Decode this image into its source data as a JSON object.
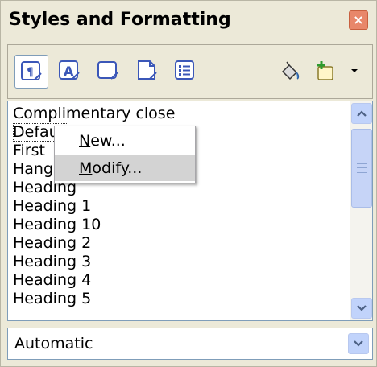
{
  "panel": {
    "title": "Styles and Formatting",
    "close_label": "×"
  },
  "toolbar": {
    "buttons": [
      {
        "name": "paragraph-styles",
        "icon": "paragraph-styles-icon"
      },
      {
        "name": "character-styles",
        "icon": "character-styles-icon"
      },
      {
        "name": "frame-styles",
        "icon": "frame-styles-icon"
      },
      {
        "name": "page-styles",
        "icon": "page-styles-icon"
      },
      {
        "name": "list-styles",
        "icon": "list-styles-icon"
      },
      {
        "name": "fill-format-mode",
        "icon": "paint-bucket-icon"
      },
      {
        "name": "new-style-from-selection",
        "icon": "new-style-icon"
      }
    ]
  },
  "styles_list": {
    "items": [
      "Complimentary close",
      "Default",
      "First",
      "Hanging indent",
      "Heading",
      "Heading 1",
      "Heading 10",
      "Heading 2",
      "Heading 3",
      "Heading 4",
      "Heading 5"
    ],
    "selected_index": 1
  },
  "context_menu": {
    "items": [
      {
        "label_prefix": "",
        "accel": "N",
        "label_rest": "ew..."
      },
      {
        "label_prefix": "",
        "accel": "M",
        "label_rest": "odify..."
      }
    ],
    "highlighted_index": 1
  },
  "filter": {
    "value": "Automatic"
  },
  "colors": {
    "panel_bg": "#ece9d8",
    "selection_border": "#7f9db9",
    "scrollbar_button": "#c1d3fb"
  }
}
